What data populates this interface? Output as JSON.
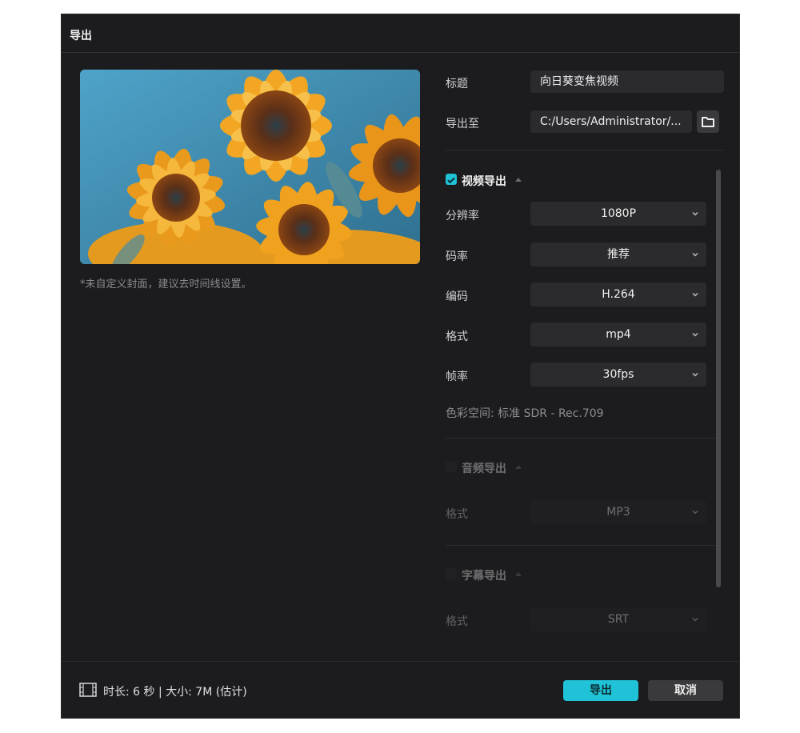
{
  "dialog": {
    "title": "导出",
    "cover_note": "*未自定义封面，建议去时间线设置。",
    "title_label": "标题",
    "title_value": "向日葵变焦视频",
    "export_to_label": "导出至",
    "export_path": "C:/Users/Administrator/..."
  },
  "video": {
    "heading": "视频导出",
    "enabled": true,
    "resolution": {
      "label": "分辨率",
      "value": "1080P"
    },
    "bitrate": {
      "label": "码率",
      "value": "推荐"
    },
    "codec": {
      "label": "编码",
      "value": "H.264"
    },
    "format": {
      "label": "格式",
      "value": "mp4"
    },
    "framerate": {
      "label": "帧率",
      "value": "30fps"
    },
    "colorspace": "色彩空间:  标准 SDR - Rec.709"
  },
  "audio": {
    "heading": "音频导出",
    "enabled": false,
    "format": {
      "label": "格式",
      "value": "MP3"
    }
  },
  "subtitle": {
    "heading": "字幕导出",
    "enabled": false,
    "format": {
      "label": "格式",
      "value": "SRT"
    }
  },
  "footer": {
    "info": "时长: 6 秒 | 大小: 7M (估计)",
    "export_label": "导出",
    "cancel_label": "取消"
  },
  "colors": {
    "accent": "#1fc2d6",
    "background": "#1c1c1e",
    "field": "#2b2b2e"
  }
}
